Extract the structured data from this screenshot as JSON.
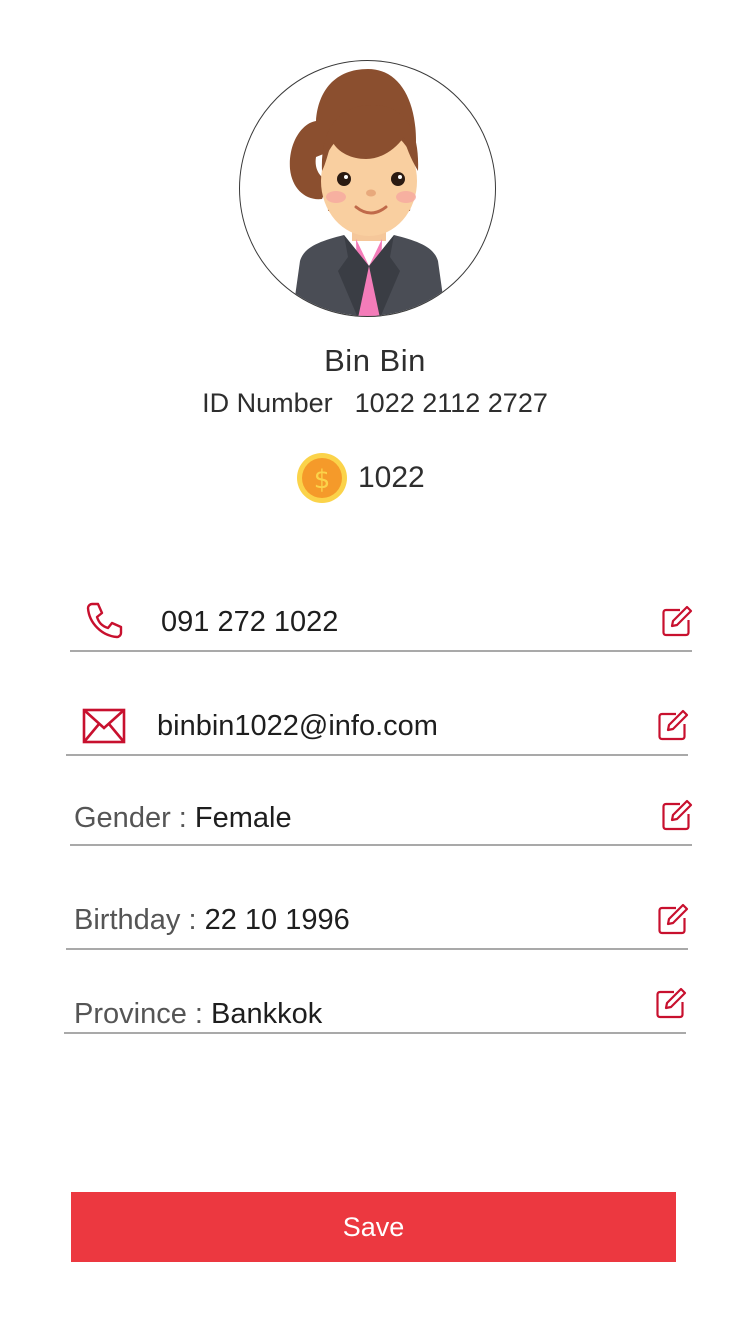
{
  "profile": {
    "name": "Bin Bin",
    "id_label": "ID Number",
    "id_value": "1022 2112 2727",
    "coins": "1022"
  },
  "fields": {
    "phone": {
      "value": "091 272 1022"
    },
    "email": {
      "value": "binbin1022@info.com"
    },
    "gender": {
      "label": "Gender",
      "separator": ":",
      "value": "Female"
    },
    "birthday": {
      "label": "Birthday",
      "separator": ":",
      "value": "22 10 1996"
    },
    "province": {
      "label": "Province",
      "separator": ":",
      "value": "Bankkok"
    }
  },
  "actions": {
    "save_label": "Save"
  },
  "colors": {
    "accent": "#c8102e",
    "save_button": "#ec3840",
    "coin": "#f5b52b",
    "divider": "#a9a9a9"
  },
  "icons": [
    "phone-icon",
    "email-icon",
    "edit-icon",
    "coin-icon",
    "avatar"
  ]
}
